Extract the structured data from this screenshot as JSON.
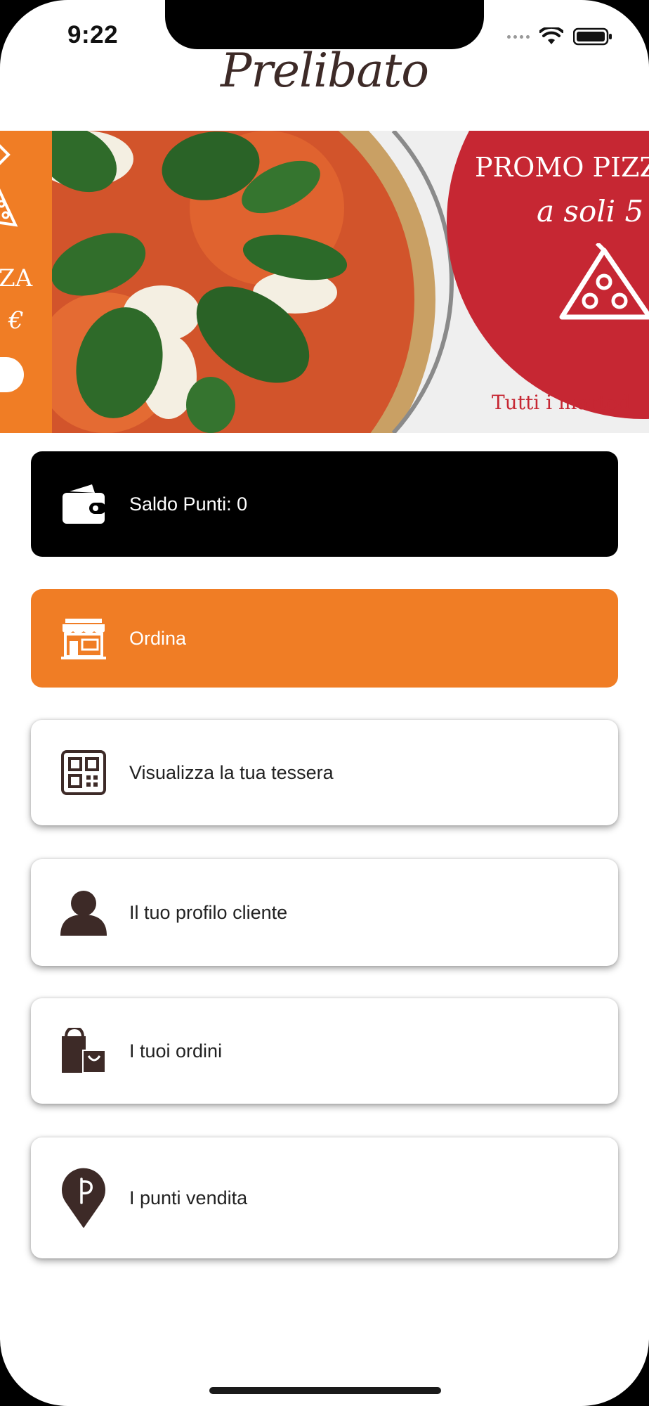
{
  "status_bar": {
    "time": "9:22"
  },
  "header": {
    "logo_text": "Prelibato"
  },
  "banner": {
    "promo_line1": "PROMO PIZZ",
    "promo_line2": "a soli 5",
    "promo_line3": "Tutti i marted",
    "left_line1": "ZA",
    "left_line2": "€",
    "colors": {
      "orange": "#f07d25",
      "red": "#c62733"
    }
  },
  "menu": {
    "points": {
      "label": "Saldo Punti: 0",
      "icon": "wallet-icon"
    },
    "order": {
      "label": "Ordina",
      "icon": "store-icon"
    },
    "card": {
      "label": "Visualizza la tua tessera",
      "icon": "qr-code-icon"
    },
    "profile": {
      "label": "Il tuo profilo cliente",
      "icon": "user-icon"
    },
    "orders": {
      "label": "I tuoi ordini",
      "icon": "shopping-bag-icon"
    },
    "stores": {
      "label": "I punti vendita",
      "icon": "location-pin-icon"
    }
  },
  "colors": {
    "brown": "#3d2a27",
    "accent": "#f07d25",
    "black": "#000000"
  }
}
